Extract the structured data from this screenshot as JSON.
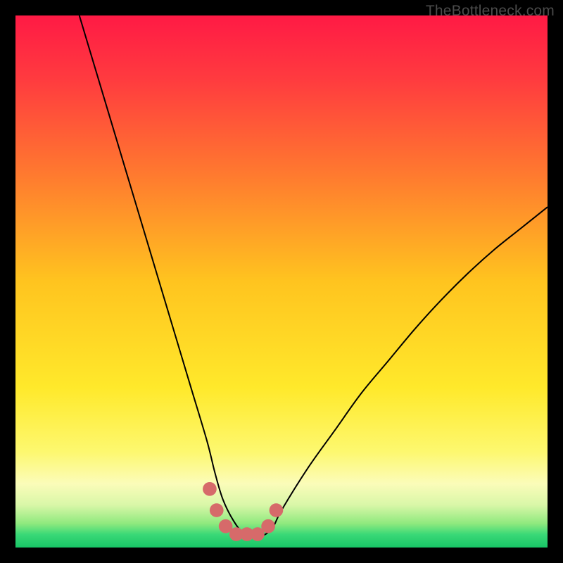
{
  "watermark": "TheBottleneck.com",
  "chart_data": {
    "type": "line",
    "title": "",
    "xlabel": "",
    "ylabel": "",
    "xlim": [
      0,
      100
    ],
    "ylim": [
      0,
      100
    ],
    "grid": false,
    "legend": false,
    "gradient_stops": [
      {
        "offset": 0.0,
        "color": "#ff1a45"
      },
      {
        "offset": 0.12,
        "color": "#ff3b3f"
      },
      {
        "offset": 0.3,
        "color": "#ff7a2f"
      },
      {
        "offset": 0.5,
        "color": "#ffc41f"
      },
      {
        "offset": 0.7,
        "color": "#ffe92b"
      },
      {
        "offset": 0.82,
        "color": "#fdf86f"
      },
      {
        "offset": 0.88,
        "color": "#fbfcb9"
      },
      {
        "offset": 0.92,
        "color": "#d9f7a8"
      },
      {
        "offset": 0.955,
        "color": "#8fe97e"
      },
      {
        "offset": 0.975,
        "color": "#3bd977"
      },
      {
        "offset": 1.0,
        "color": "#17c566"
      }
    ],
    "series": [
      {
        "name": "bottleneck-curve",
        "x": [
          12,
          15,
          18,
          21,
          24,
          27,
          30,
          33,
          36,
          37.5,
          39,
          41,
          43,
          45,
          47,
          48.5,
          50,
          55,
          60,
          65,
          70,
          75,
          80,
          85,
          90,
          95,
          100
        ],
        "y": [
          100,
          90,
          80,
          70,
          60,
          50,
          40,
          30,
          20,
          14,
          9,
          5,
          2.5,
          2,
          2.5,
          4,
          7,
          15,
          22,
          29,
          35,
          41,
          46.5,
          51.5,
          56,
          60,
          64
        ]
      }
    ],
    "markers": {
      "name": "flat-region-dots",
      "color": "#d66a6a",
      "radius_pct": 1.3,
      "points": [
        {
          "x": 36.5,
          "y": 11
        },
        {
          "x": 37.8,
          "y": 7
        },
        {
          "x": 39.5,
          "y": 4
        },
        {
          "x": 41.5,
          "y": 2.5
        },
        {
          "x": 43.5,
          "y": 2.5
        },
        {
          "x": 45.5,
          "y": 2.5
        },
        {
          "x": 47.5,
          "y": 4
        },
        {
          "x": 49.0,
          "y": 7
        }
      ]
    }
  }
}
